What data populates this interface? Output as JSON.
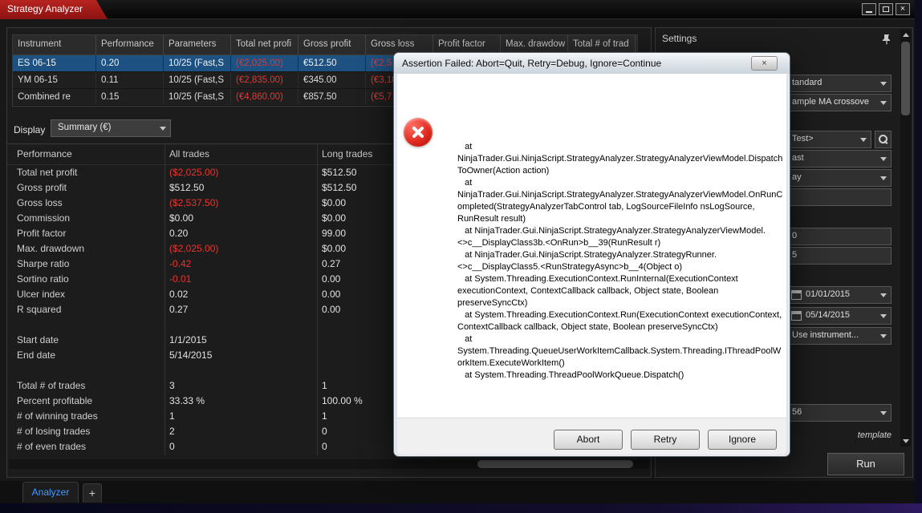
{
  "window": {
    "title": "Strategy Analyzer"
  },
  "icons": {
    "close": "×"
  },
  "results_table": {
    "columns": [
      "Instrument",
      "Performance",
      "Parameters",
      "Total net profi",
      "Gross profit",
      "Gross loss",
      "Profit factor",
      "Max. drawdow",
      "Total # of trad"
    ],
    "rows": [
      {
        "selected": true,
        "cells": [
          "ES 06-15",
          "0.20",
          "10/25 (Fast,S",
          "(€2,025.00)",
          "€512.50",
          "(€2,5"
        ]
      },
      {
        "selected": false,
        "cells": [
          "YM 06-15",
          "0.11",
          "10/25 (Fast,S",
          "(€2,835.00)",
          "€345.00",
          "(€3,18"
        ]
      },
      {
        "selected": false,
        "cells": [
          "Combined re",
          "0.15",
          "10/25 (Fast,S",
          "(€4,860.00)",
          "€857.50",
          "(€5,7"
        ]
      }
    ]
  },
  "display": {
    "label": "Display",
    "value": "Summary (€)"
  },
  "performance_table": {
    "columns": [
      "Performance",
      "All trades",
      "Long trades"
    ],
    "rows": [
      [
        "Total net profit",
        "($2,025.00)",
        "$512.50"
      ],
      [
        "Gross profit",
        "$512.50",
        "$512.50"
      ],
      [
        "Gross loss",
        "($2,537.50)",
        "$0.00"
      ],
      [
        "Commission",
        "$0.00",
        "$0.00"
      ],
      [
        "Profit factor",
        "0.20",
        "99.00"
      ],
      [
        "Max. drawdown",
        "($2,025.00)",
        "$0.00"
      ],
      [
        "Sharpe ratio",
        "-0.42",
        "0.27"
      ],
      [
        "Sortino ratio",
        "-0.01",
        "0.00"
      ],
      [
        "Ulcer index",
        "0.02",
        "0.00"
      ],
      [
        "R squared",
        "0.27",
        "0.00"
      ],
      [
        "",
        "",
        ""
      ],
      [
        "Start date",
        "1/1/2015",
        ""
      ],
      [
        "End date",
        "5/14/2015",
        ""
      ],
      [
        "",
        "",
        ""
      ],
      [
        "Total # of trades",
        "3",
        "1"
      ],
      [
        "Percent profitable",
        "33.33 %",
        "100.00 %"
      ],
      [
        "# of winning trades",
        "1",
        "1"
      ],
      [
        "# of losing trades",
        "2",
        "0"
      ],
      [
        "# of even trades",
        "0",
        "0"
      ]
    ]
  },
  "settings": {
    "header": "Settings",
    "fields": [
      "tandard",
      "ample MA crossove",
      "Test>",
      "ast",
      "ay",
      "",
      "0",
      "5",
      "01/01/2015",
      "05/14/2015",
      "Use instrument...",
      "56"
    ],
    "template_label": "template",
    "run_label": "Run"
  },
  "tabs": {
    "analyzer": "Analyzer",
    "add": "+"
  },
  "dialog": {
    "title": "Assertion Failed: Abort=Quit, Retry=Debug, Ignore=Continue",
    "close_glyph": "×",
    "stack_trace": "   at NinjaTrader.Gui.NinjaScript.StrategyAnalyzer.StrategyAnalyzerViewModel.DispatchToOwner(Action action)\n   at NinjaTrader.Gui.NinjaScript.StrategyAnalyzer.StrategyAnalyzerViewModel.OnRunCompleted(StrategyAnalyzerTabControl tab, LogSourceFileInfo nsLogSource, RunResult result)\n   at NinjaTrader.Gui.NinjaScript.StrategyAnalyzer.StrategyAnalyzerViewModel.<>c__DisplayClass3b.<OnRun>b__39(RunResult r)\n   at NinjaTrader.Gui.NinjaScript.StrategyAnalyzer.StrategyRunner.<>c__DisplayClass5.<RunStrategyAsync>b__4(Object o)\n   at System.Threading.ExecutionContext.RunInternal(ExecutionContext executionContext, ContextCallback callback, Object state, Boolean preserveSyncCtx)\n   at System.Threading.ExecutionContext.Run(ExecutionContext executionContext, ContextCallback callback, Object state, Boolean preserveSyncCtx)\n   at System.Threading.QueueUserWorkItemCallback.System.Threading.IThreadPoolWorkItem.ExecuteWorkItem()\n   at System.Threading.ThreadPoolWorkQueue.Dispatch()",
    "buttons": {
      "abort": "Abort",
      "retry": "Retry",
      "ignore": "Ignore"
    }
  },
  "colors": {
    "selection_blue": "#1d5181",
    "negative_red": "#e8352e",
    "title_tab_red": "#a01815",
    "tab_text_blue": "#3f9bff"
  }
}
